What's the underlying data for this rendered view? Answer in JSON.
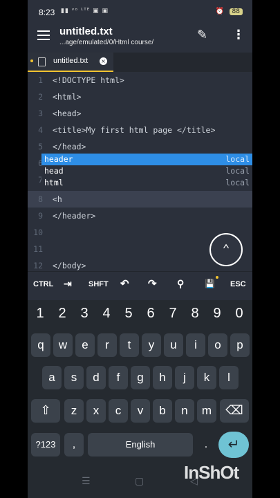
{
  "status": {
    "time": "8:23",
    "icons": "▮▮ ᵛᵒ ᴸᵀᴱ ▣ ▣",
    "alarm": "⏰",
    "battery": "88"
  },
  "appbar": {
    "title": "untitled.txt",
    "path": "...age/emulated/0/Html course/"
  },
  "tab": {
    "label": "untitled.txt",
    "close": "×"
  },
  "editor": {
    "lines": [
      {
        "n": "1",
        "code": "<!DOCTYPE html>"
      },
      {
        "n": "2",
        "code": "<html>"
      },
      {
        "n": "3",
        "code": "<head>"
      },
      {
        "n": "4",
        "code": "<title>My first html page </title>"
      },
      {
        "n": "5",
        "code": "</head>"
      },
      {
        "n": "6",
        "code": ""
      },
      {
        "n": "7",
        "code": ""
      },
      {
        "n": "8",
        "code": "<h"
      },
      {
        "n": "9",
        "code": "</header>"
      },
      {
        "n": "10",
        "code": ""
      },
      {
        "n": "11",
        "code": ""
      },
      {
        "n": "12",
        "code": "</body>"
      }
    ],
    "autocomplete": [
      {
        "label": "header",
        "scope": "local"
      },
      {
        "label": "head",
        "scope": "local"
      },
      {
        "label": "html",
        "scope": "local"
      }
    ],
    "scroll_top_icon": "⌃"
  },
  "extra_keys": {
    "ctrl": "CTRL",
    "tab": "⇥",
    "shift": "SHFT",
    "undo": "↶",
    "redo": "↷",
    "search": "⚲",
    "save": "💾",
    "esc": "ESC"
  },
  "keyboard": {
    "numbers": [
      "1",
      "2",
      "3",
      "4",
      "5",
      "6",
      "7",
      "8",
      "9",
      "0"
    ],
    "row1": [
      "q",
      "w",
      "e",
      "r",
      "t",
      "y",
      "u",
      "i",
      "o",
      "p"
    ],
    "row2": [
      "a",
      "s",
      "d",
      "f",
      "g",
      "h",
      "j",
      "k",
      "l"
    ],
    "row3": [
      "z",
      "x",
      "c",
      "v",
      "b",
      "n",
      "m"
    ],
    "shift": "⇧",
    "backspace": "⌫",
    "symbols": "?123",
    "comma": ",",
    "space": "English",
    "period": ".",
    "enter": "↵"
  },
  "nav": {
    "recents": "☰",
    "home": "▢",
    "back": "◁"
  },
  "watermark": "InShOt"
}
